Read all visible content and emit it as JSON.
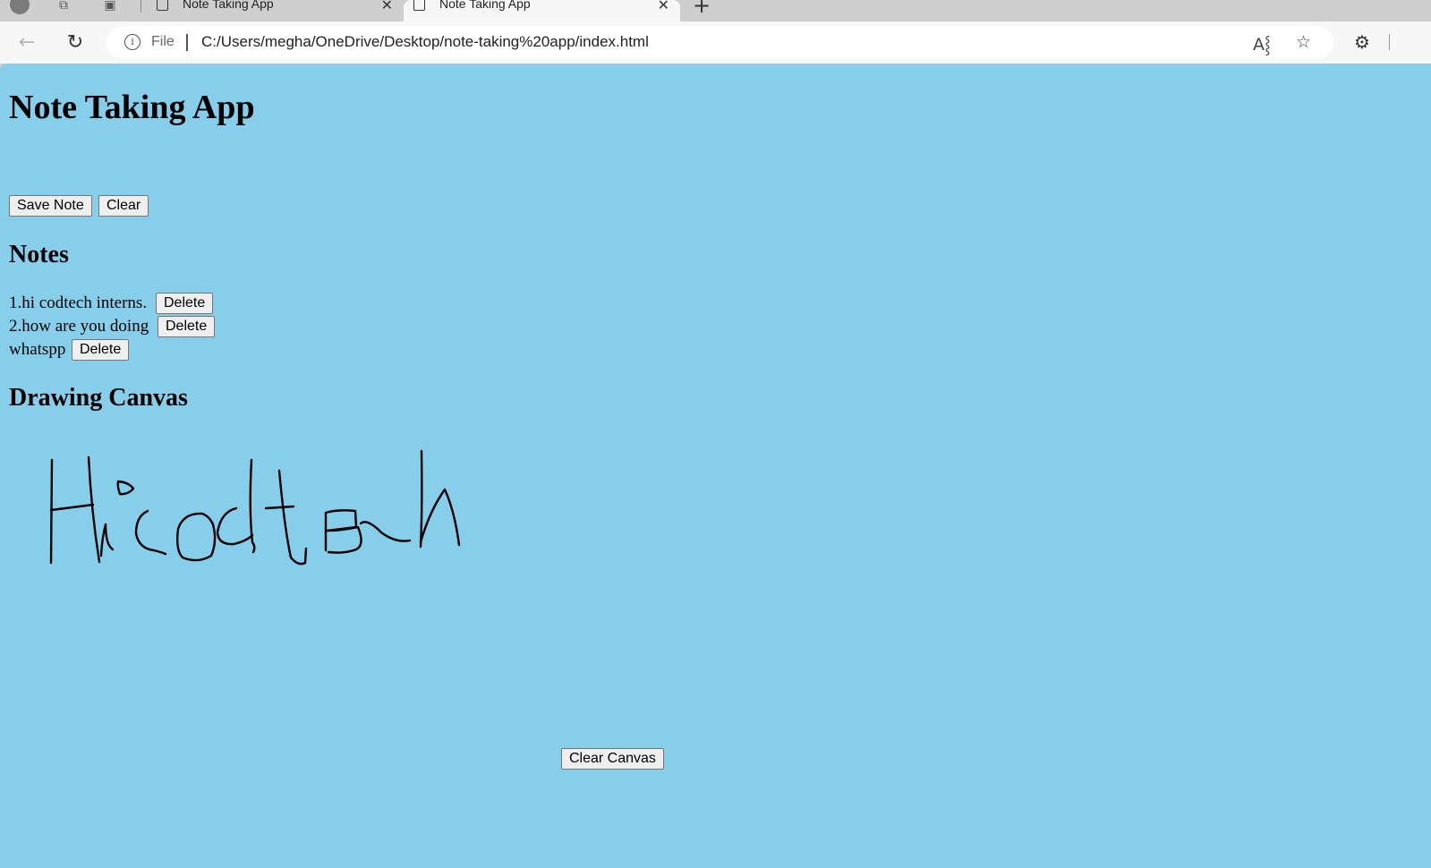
{
  "browser": {
    "tabs": [
      {
        "title": "Note Taking App"
      },
      {
        "title": "Note Taking App"
      }
    ],
    "new_tab_glyph": "+",
    "address": {
      "scheme_label": "File",
      "url": "C:/Users/megha/OneDrive/Desktop/note-taking%20app/index.html"
    },
    "icons": [
      "profile-icon",
      "workspaces-icon",
      "vertical-tabs-icon",
      "back-icon",
      "reload-icon",
      "info-icon",
      "read-aloud-icon",
      "favorite-star-icon",
      "extensions-icon"
    ]
  },
  "page": {
    "title": "Note Taking App",
    "save_label": "Save Note",
    "clear_label": "Clear",
    "notes_heading": "Notes",
    "notes": [
      {
        "text": "1.hi codtech interns.",
        "delete_label": "Delete"
      },
      {
        "text": "2.how are you doing",
        "delete_label": "Delete"
      },
      {
        "text": "whatspp",
        "delete_label": "Delete"
      }
    ],
    "canvas_heading": "Drawing Canvas",
    "canvas_drawing": "handwritten \"Hicodtech\"",
    "clear_canvas_label": "Clear Canvas",
    "background_color": "#87ceeb"
  }
}
